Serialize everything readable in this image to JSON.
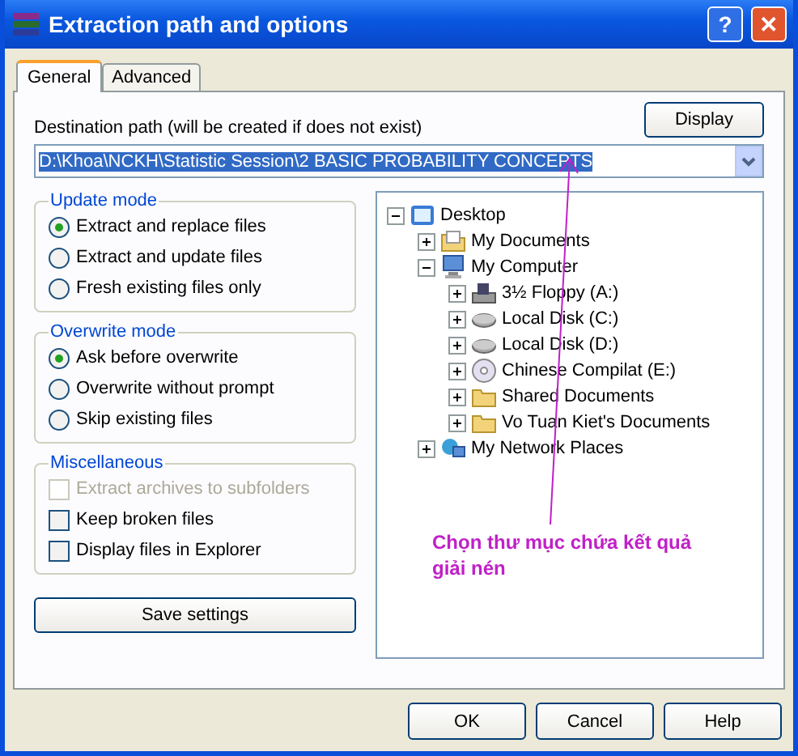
{
  "window": {
    "title": "Extraction path and options",
    "buttons": [
      {
        "kind": "help",
        "label": "?"
      },
      {
        "kind": "close",
        "label": "✕"
      }
    ]
  },
  "tabs": [
    {
      "label": "General",
      "selected": true
    },
    {
      "label": "Advanced",
      "selected": false
    }
  ],
  "destination": {
    "label": "Destination path (will be created if does not exist)",
    "value": "D:\\Khoa\\NCKH\\Statistic Session\\2 BASIC PROBABILITY CONCEPTS",
    "display_button": "Display"
  },
  "update_mode": {
    "title": "Update mode",
    "options": [
      {
        "label": "Extract and replace files",
        "selected": true
      },
      {
        "label": "Extract and update files",
        "selected": false
      },
      {
        "label": "Fresh existing files only",
        "selected": false
      }
    ]
  },
  "overwrite_mode": {
    "title": "Overwrite mode",
    "options": [
      {
        "label": "Ask before overwrite",
        "selected": true
      },
      {
        "label": "Overwrite without prompt",
        "selected": false
      },
      {
        "label": "Skip existing files",
        "selected": false
      }
    ]
  },
  "miscellaneous": {
    "title": "Miscellaneous",
    "options": [
      {
        "label": "Extract archives to subfolders",
        "checked": false,
        "disabled": true
      },
      {
        "label": "Keep broken files",
        "checked": false,
        "disabled": false
      },
      {
        "label": "Display files in Explorer",
        "checked": false,
        "disabled": false
      }
    ]
  },
  "save_button": "Save settings",
  "tree": [
    {
      "label": "Desktop",
      "kind": "desktop",
      "expanded": true,
      "children": [
        {
          "label": "My Documents",
          "kind": "documents",
          "expanded": false
        },
        {
          "label": "My Computer",
          "kind": "computer",
          "expanded": true,
          "children": [
            {
              "label": "3½ Floppy (A:)",
              "kind": "floppy",
              "expanded": false
            },
            {
              "label": "Local Disk (C:)",
              "kind": "disk",
              "expanded": false
            },
            {
              "label": "Local Disk (D:)",
              "kind": "disk",
              "expanded": false
            },
            {
              "label": "Chinese Compilat (E:)",
              "kind": "cd",
              "expanded": false
            },
            {
              "label": "Shared Documents",
              "kind": "folder",
              "expanded": false
            },
            {
              "label": "Vo Tuan Kiet's Documents",
              "kind": "folder",
              "expanded": false
            }
          ]
        },
        {
          "label": "My Network Places",
          "kind": "network",
          "expanded": false
        }
      ]
    }
  ],
  "annotation": {
    "text": "Chọn thư mục chứa kết quả giải nén"
  },
  "buttons": [
    "OK",
    "Cancel",
    "Help"
  ]
}
